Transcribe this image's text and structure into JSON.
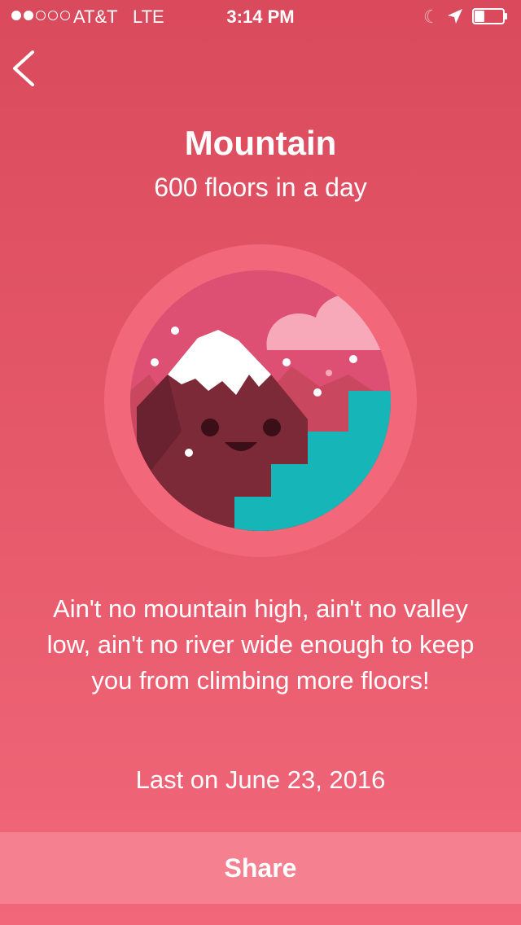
{
  "status_bar": {
    "signal_filled": 2,
    "signal_total": 5,
    "carrier": "AT&T",
    "network": "LTE",
    "time": "3:14 PM",
    "icons": [
      "moon-icon",
      "location-arrow-icon",
      "battery-icon"
    ],
    "battery_level": 0.35
  },
  "header": {
    "back_icon": "chevron-left-icon",
    "title": "Mountain",
    "subtitle": "600 floors in a day"
  },
  "badge": {
    "icon": "mountain-badge",
    "colors": {
      "ring": "#f3677a",
      "sky": "#e1567a",
      "cloud": "#f7a9b9",
      "snow": "#ffffff",
      "mountain": "#7c2a38",
      "stairs": "#16b5b8"
    }
  },
  "description": "Ain't no mountain high, ain't no valley low, ain't no river wide enough to keep you from climbing more floors!",
  "last_earned": "Last on June 23, 2016",
  "share_label": "Share",
  "colors": {
    "background_top": "#d94a5c",
    "background_bottom": "#f2677a",
    "share_button": "#f58190"
  }
}
